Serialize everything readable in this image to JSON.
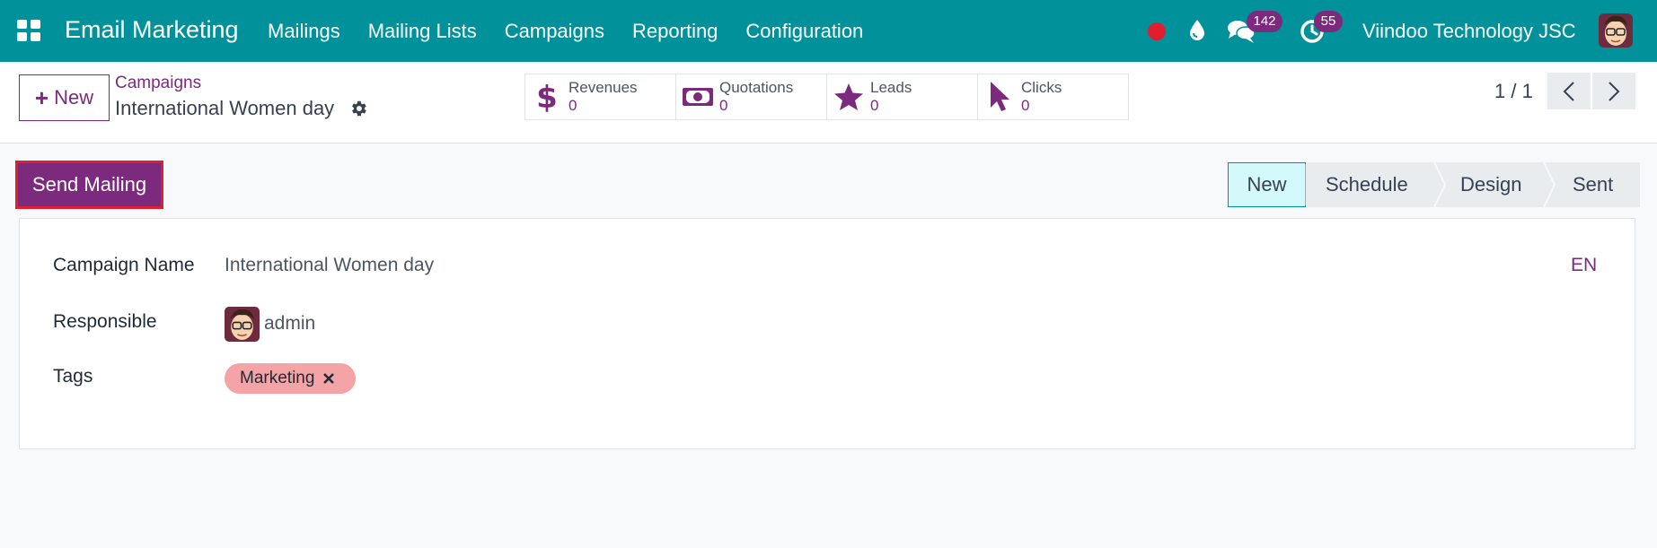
{
  "navbar": {
    "brand": "Email Marketing",
    "menu": [
      "Mailings",
      "Mailing Lists",
      "Campaigns",
      "Reporting",
      "Configuration"
    ],
    "messages_count": "142",
    "activities_count": "55",
    "company": "Viindoo Technology JSC",
    "colors": {
      "bar": "#00919a",
      "badge": "#7b2a7e",
      "record": "#e11d2e"
    }
  },
  "control": {
    "new_label": "New",
    "breadcrumb_parent": "Campaigns",
    "breadcrumb_current": "International Women day",
    "smart_buttons": [
      {
        "icon": "dollar-icon",
        "label": "Revenues",
        "value": "0"
      },
      {
        "icon": "money-bill-icon",
        "label": "Quotations",
        "value": "0"
      },
      {
        "icon": "star-icon",
        "label": "Leads",
        "value": "0"
      },
      {
        "icon": "pointer-icon",
        "label": "Clicks",
        "value": "0"
      }
    ],
    "pager": "1 / 1"
  },
  "statusbar": {
    "send_label": "Send Mailing",
    "stages": [
      "New",
      "Schedule",
      "Design",
      "Sent"
    ],
    "active_stage": "New"
  },
  "form": {
    "campaign_name_label": "Campaign Name",
    "campaign_name_value": "International Women day",
    "responsible_label": "Responsible",
    "responsible_value": "admin",
    "tags_label": "Tags",
    "tags": [
      "Marketing"
    ],
    "lang": "EN",
    "colors": {
      "accent": "#7b2a7e",
      "tag": "#f4a3a6"
    }
  }
}
